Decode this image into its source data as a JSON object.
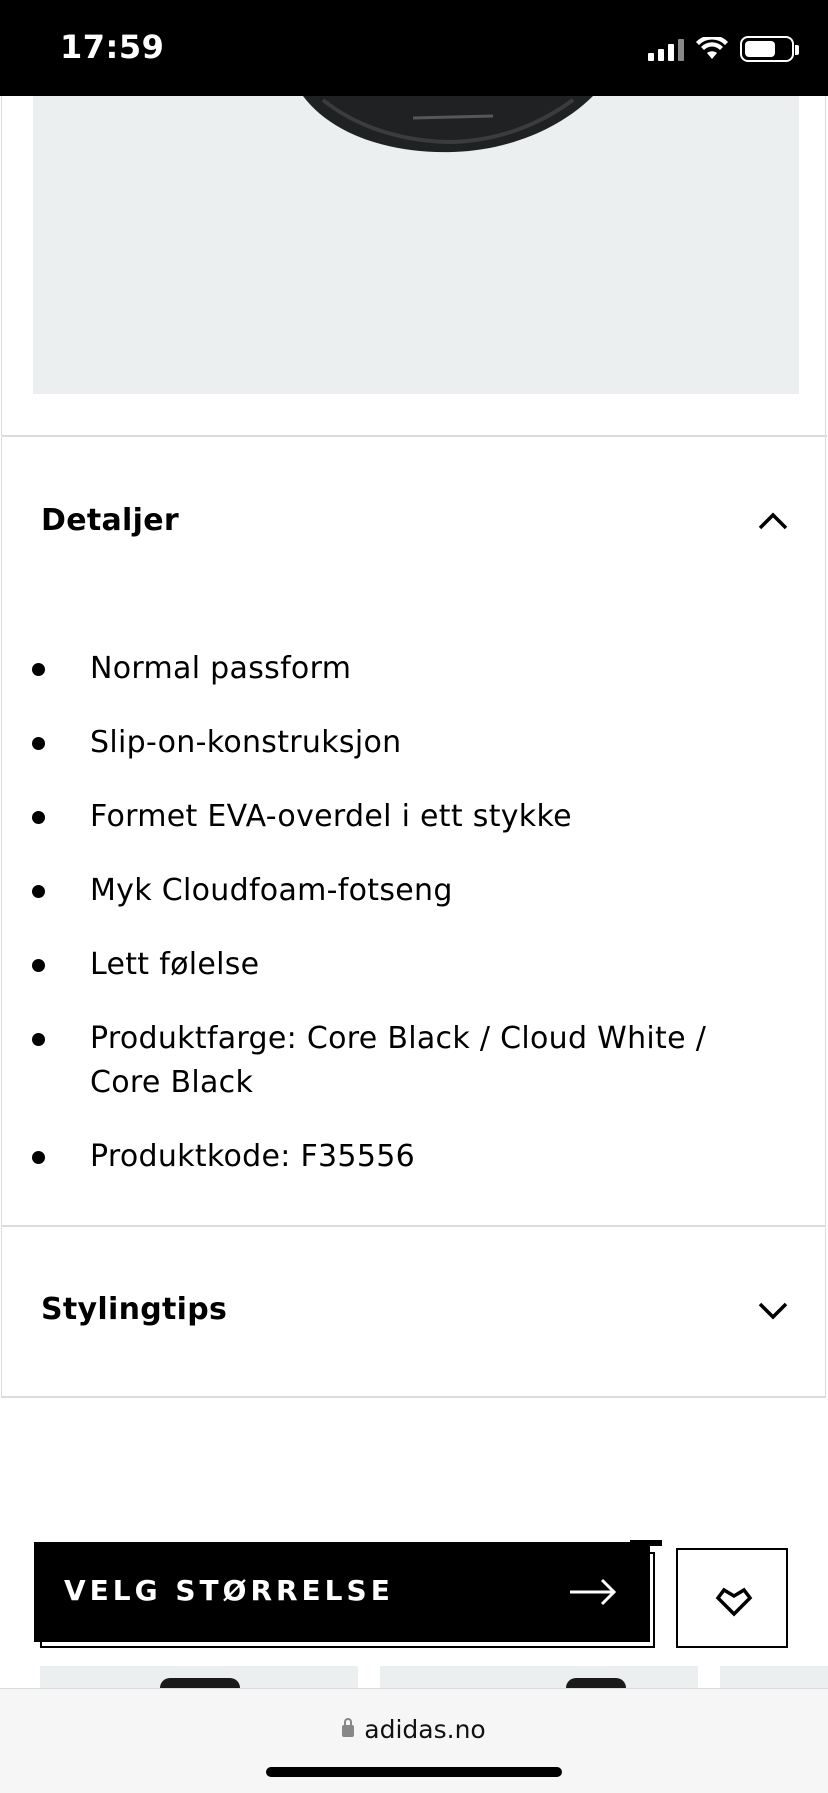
{
  "status_bar": {
    "time": "17:59"
  },
  "product_image": {
    "alt": "Product image"
  },
  "details": {
    "title": "Detaljer",
    "items": [
      "Normal passform",
      "Slip-on-konstruksjon",
      "Formet EVA-overdel i ett stykke",
      "Myk Cloudfoam-fotseng",
      "Lett følelse",
      "Produktfarge: Core Black / Cloud White / Core Black",
      "Produktkode: F35556"
    ]
  },
  "styling": {
    "title": "Stylingtips"
  },
  "cta": {
    "label": "VELG STØRRELSE"
  },
  "browser": {
    "url": "adidas.no"
  },
  "icons": {
    "chevron_up": "chevron-up-icon",
    "chevron_down": "chevron-down-icon",
    "arrow_right": "arrow-right-icon",
    "heart": "heart-icon",
    "lock": "lock-icon"
  },
  "colors": {
    "accent": "#000000",
    "image_bg": "#eceff0",
    "divider": "#d9dcdd"
  }
}
